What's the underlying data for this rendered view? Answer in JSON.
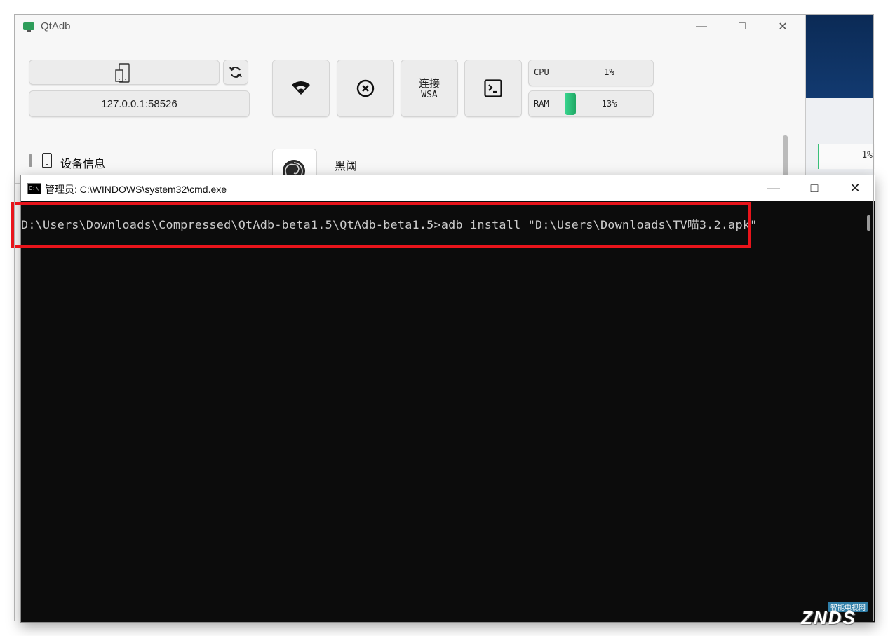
{
  "qtadb": {
    "title": "QtAdb",
    "address": "127.0.0.1:58526",
    "wsa_line1": "连接",
    "wsa_line2": "WSA",
    "cpu_label": "CPU",
    "cpu_value": "1%",
    "ram_label": "RAM",
    "ram_value": "13%",
    "ram_fraction": 0.13,
    "device_info": "设备信息",
    "item_label": "黑阈"
  },
  "cmd": {
    "title": "管理员: C:\\WINDOWS\\system32\\cmd.exe",
    "command_line": "D:\\Users\\Downloads\\Compressed\\QtAdb-beta1.5\\QtAdb-beta1.5>adb install \"D:\\Users\\Downloads\\TV喵3.2.apk\""
  },
  "background": {
    "cpu_partial": "1%"
  },
  "watermark": {
    "text": "ZNDS",
    "sub": "智能电视网"
  },
  "colors": {
    "highlight": "#e8141b",
    "ram_bar": "#2ecc8a",
    "console_bg": "#0c0c0c"
  },
  "icons": {
    "phone": "phone-outline-icon",
    "refresh": "refresh-icon",
    "wifi": "wifi-icon",
    "disconnect": "close-circle-icon",
    "terminal": "terminal-icon",
    "device": "device-icon",
    "app": "spiral-app-icon"
  }
}
